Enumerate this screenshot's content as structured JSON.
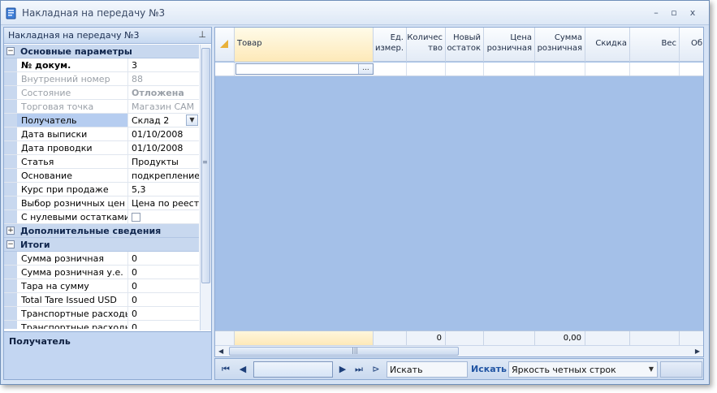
{
  "window": {
    "title": "Накладная на передачу №3",
    "controls": [
      "–",
      "▫",
      "x"
    ]
  },
  "left_panel": {
    "title": "Накладная на передачу №3",
    "pin_icon": "pin-icon",
    "categories": {
      "main": "Основные параметры",
      "extra": "Дополнительные сведения",
      "totals": "Итоги"
    },
    "main_rows": [
      {
        "name": "№ докум.",
        "value": "3"
      },
      {
        "name": "Внутренний номер",
        "value": "88"
      },
      {
        "name": "Состояние",
        "value": "Отложена"
      },
      {
        "name": "Торговая точка",
        "value": "Магазин САМ"
      },
      {
        "name": "Получатель",
        "value": "Склад 2"
      },
      {
        "name": "Дата выписки",
        "value": "01/10/2008"
      },
      {
        "name": "Дата проводки",
        "value": "01/10/2008"
      },
      {
        "name": "Статья",
        "value": "Продукты"
      },
      {
        "name": "Основание",
        "value": "подкрепление"
      },
      {
        "name": "Курс при продаже",
        "value": "5,3"
      },
      {
        "name": "Выбор розничных цен",
        "value": "Цена по реестру"
      },
      {
        "name": "С нулевыми остатками",
        "value": ""
      }
    ],
    "totals_rows": [
      {
        "name": "Сумма розничная",
        "value": "0"
      },
      {
        "name": "Сумма розничная у.е.",
        "value": "0"
      },
      {
        "name": "Тара на сумму",
        "value": "0"
      },
      {
        "name": "Total Tare Issued USD",
        "value": "0"
      },
      {
        "name": "Транспортные расходы",
        "value": "0"
      },
      {
        "name": "Транспортные расходы I",
        "value": "0"
      }
    ],
    "description_title": "Получатель"
  },
  "grid": {
    "columns": [
      "Товар",
      "Ед.\nизмер.",
      "Количес\nтво",
      "Новый\nостаток",
      "Цена\nрозничная",
      "Сумма\nрозничная",
      "Скидка",
      "Вес",
      "Об"
    ],
    "filter_button": "...",
    "footer": {
      "qty_total": "0",
      "sum_total": "0,00"
    }
  },
  "navbar": {
    "search_value": "Искать",
    "search_button": "Искать",
    "brightness_value": "Яркость четных строк"
  }
}
